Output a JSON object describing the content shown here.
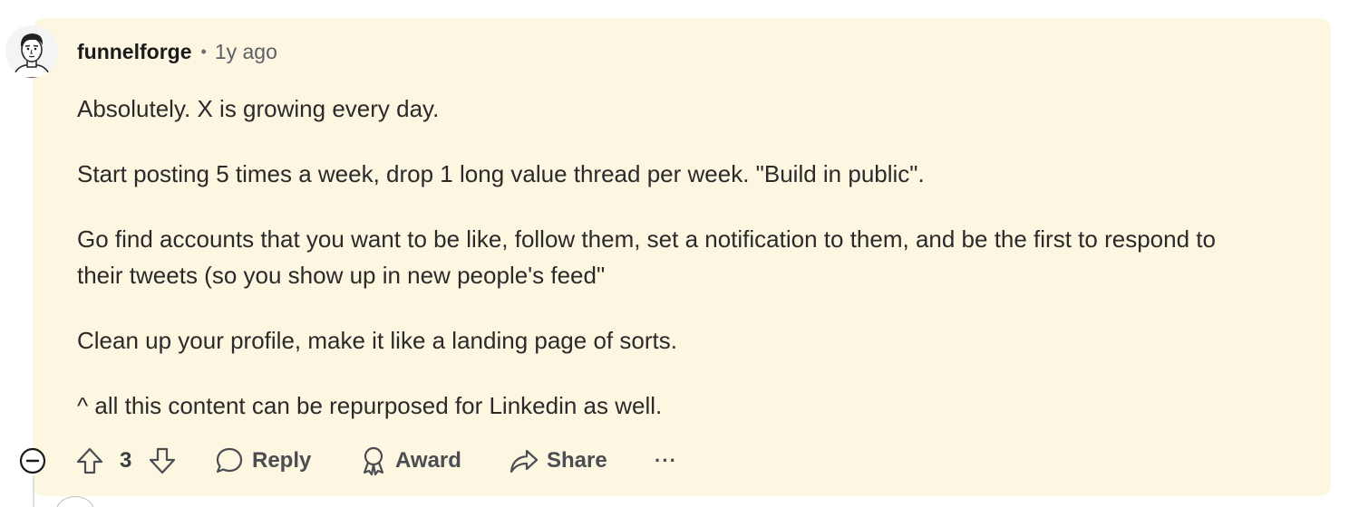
{
  "comment": {
    "author": "funnelforge",
    "separator": "•",
    "time_ago": "1y ago",
    "paragraphs": [
      "Absolutely. X is growing every day.",
      "Start posting 5 times a week, drop 1 long value thread per week. \"Build in public\".",
      "Go find accounts that you want to be like, follow them, set a notification to them, and be the first to respond to their tweets (so you show up in new people's feed\"",
      "Clean up your profile, make it like a landing page of sorts.",
      "^ all this content can be repurposed for Linkedin as well."
    ],
    "background_color": "#fdf7e1"
  },
  "actions": {
    "vote_count": "3",
    "reply_label": "Reply",
    "award_label": "Award",
    "share_label": "Share",
    "more_label": "···"
  },
  "icons": {
    "collapse": "minus-circle-icon",
    "upvote": "arrow-up-icon",
    "downvote": "arrow-down-icon",
    "reply": "speech-bubble-icon",
    "award": "award-ribbon-icon",
    "share": "share-arrow-icon",
    "more": "ellipsis-icon"
  }
}
